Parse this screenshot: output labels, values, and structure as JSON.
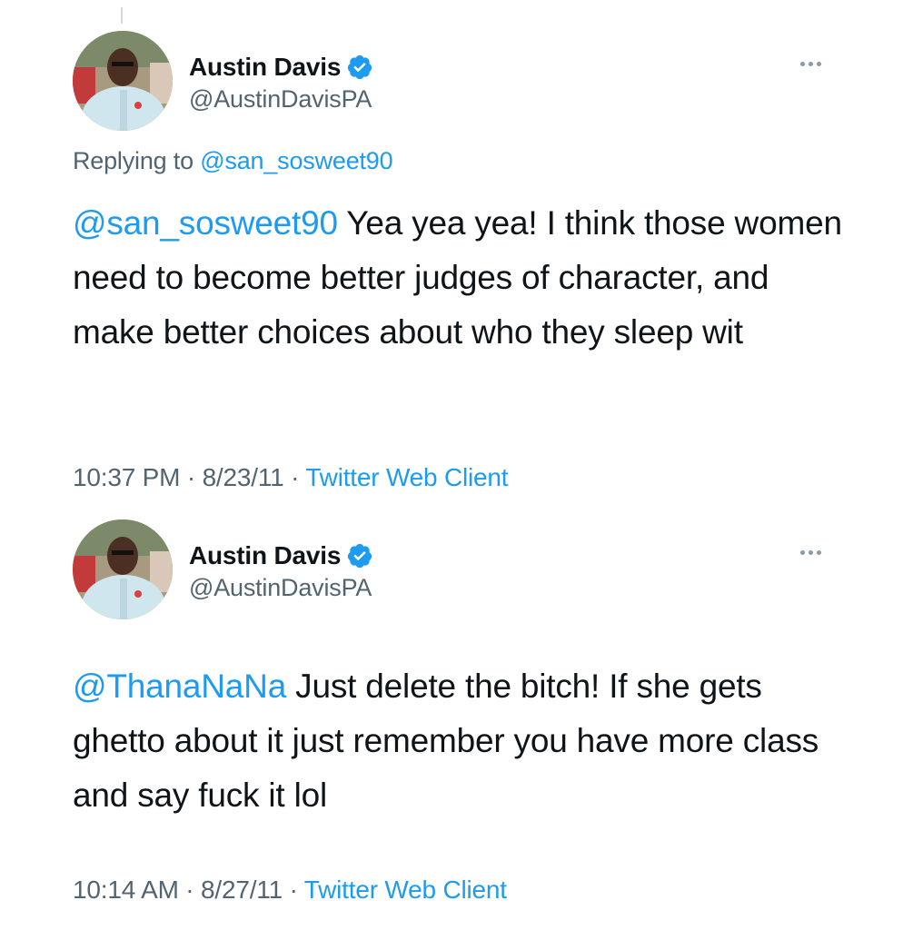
{
  "colors": {
    "link_blue": "#1d9bf0",
    "secondary_text": "#536471",
    "primary_text": "#0f1419",
    "verified_badge": "#1d9bf0"
  },
  "tweets": [
    {
      "author": {
        "display_name": "Austin Davis",
        "handle": "@AustinDavisPA",
        "verified_icon": "verified-badge-icon",
        "avatar": "profile-photo"
      },
      "more_icon": "more-options-icon",
      "replying_prefix": "Replying to",
      "replying_to": "@san_sosweet90",
      "mention": "@san_sosweet90",
      "text": " Yea yea yea! I think those women need to become better judges of character, and make better choices about who they sleep wit",
      "time": "10:37 PM",
      "date": "8/23/11",
      "separator": "·",
      "client": "Twitter Web Client"
    },
    {
      "author": {
        "display_name": "Austin Davis",
        "handle": "@AustinDavisPA",
        "verified_icon": "verified-badge-icon",
        "avatar": "profile-photo"
      },
      "more_icon": "more-options-icon",
      "mention": "@ThanaNaNa",
      "text": " Just delete the bitch! If she gets ghetto about it just remember you have more class and say fuck it lol",
      "time": "10:14 AM",
      "date": "8/27/11",
      "separator": "·",
      "client": "Twitter Web Client"
    }
  ]
}
